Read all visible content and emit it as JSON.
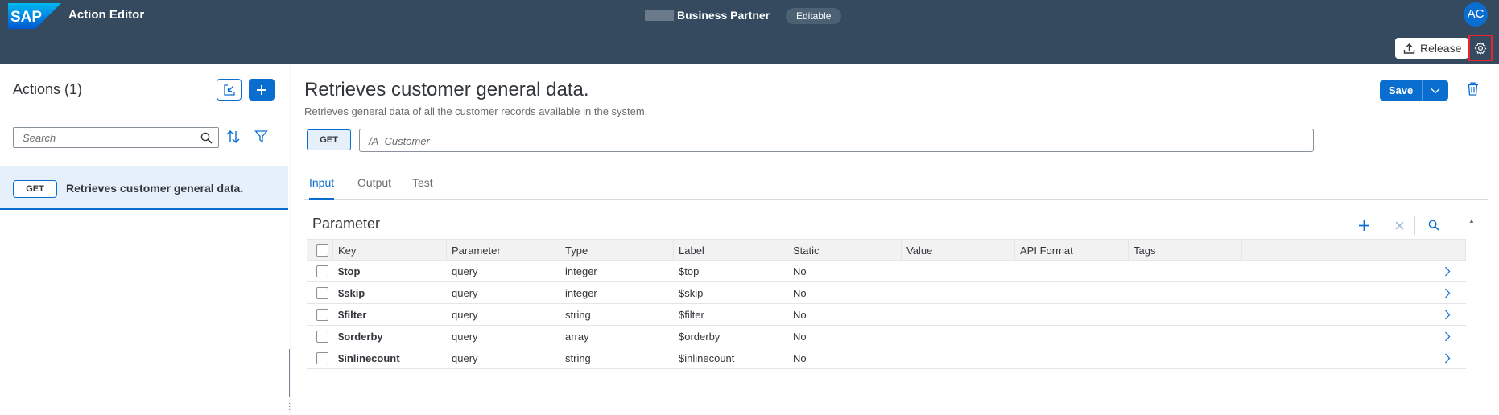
{
  "colors": {
    "shell": "#354a5f",
    "accent": "#0a6ed1",
    "highlight": "#e8252c"
  },
  "shell": {
    "app_title": "Action Editor",
    "center_title": "Business Partner",
    "status_badge": "Editable",
    "avatar_initials": "AC",
    "release_label": "Release"
  },
  "left": {
    "actions_title": "Actions (1)",
    "search_placeholder": "Search",
    "list": [
      {
        "method": "GET",
        "label": "Retrieves customer general data."
      }
    ]
  },
  "main": {
    "title": "Retrieves customer general data.",
    "subtitle": "Retrieves general data of all the customer records available in the system.",
    "save_label": "Save",
    "method": "GET",
    "url_placeholder": "/A_Customer",
    "tabs": [
      {
        "label": "Input",
        "active": true
      },
      {
        "label": "Output",
        "active": false
      },
      {
        "label": "Test",
        "active": false
      }
    ],
    "param_title": "Parameter",
    "columns": [
      "Key",
      "Parameter",
      "Type",
      "Label",
      "Static",
      "Value",
      "API Format",
      "Tags"
    ],
    "rows": [
      {
        "key": "$top",
        "parameter": "query",
        "type": "integer",
        "label": "$top",
        "static": "No",
        "value": "",
        "api_format": "",
        "tags": ""
      },
      {
        "key": "$skip",
        "parameter": "query",
        "type": "integer",
        "label": "$skip",
        "static": "No",
        "value": "",
        "api_format": "",
        "tags": ""
      },
      {
        "key": "$filter",
        "parameter": "query",
        "type": "string",
        "label": "$filter",
        "static": "No",
        "value": "",
        "api_format": "",
        "tags": ""
      },
      {
        "key": "$orderby",
        "parameter": "query",
        "type": "array",
        "label": "$orderby",
        "static": "No",
        "value": "",
        "api_format": "",
        "tags": ""
      },
      {
        "key": "$inlinecount",
        "parameter": "query",
        "type": "string",
        "label": "$inlinecount",
        "static": "No",
        "value": "",
        "api_format": "",
        "tags": ""
      }
    ]
  }
}
